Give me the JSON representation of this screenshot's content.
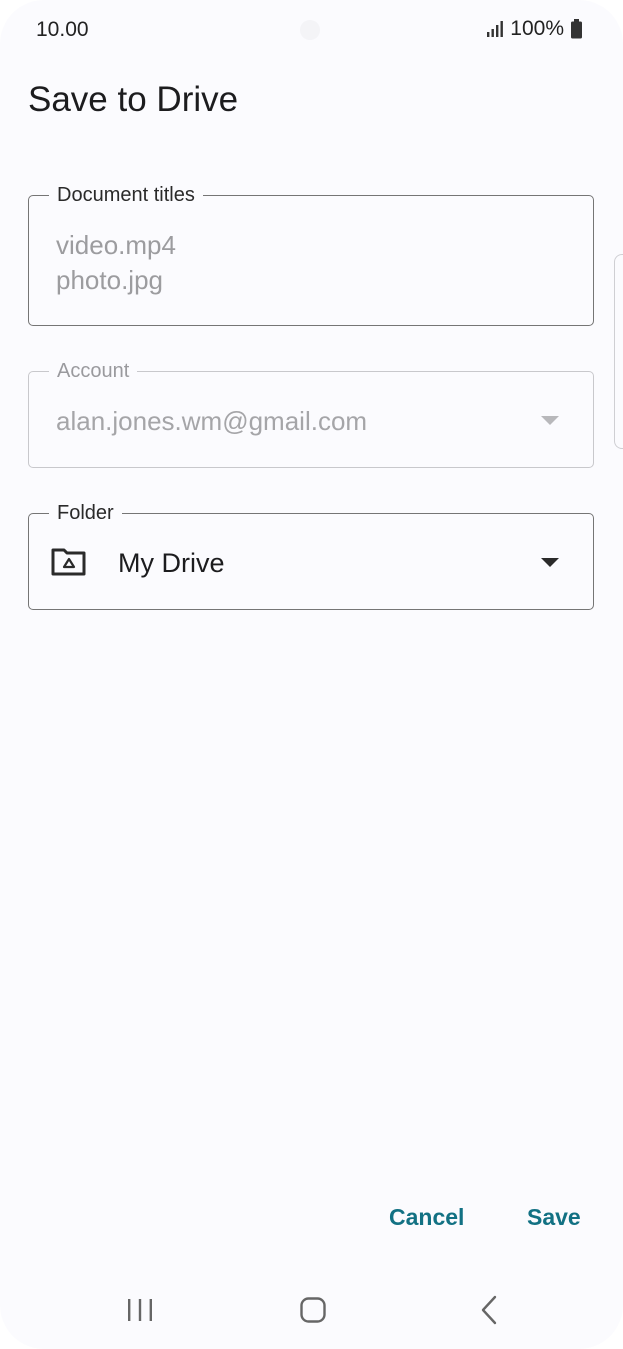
{
  "status_bar": {
    "time": "10.00",
    "battery_percent": "100%",
    "icons": [
      "signal-icon",
      "battery-icon"
    ]
  },
  "dialog": {
    "title": "Save to Drive",
    "document_titles": {
      "label": "Document titles",
      "values": [
        "video.mp4",
        "photo.jpg"
      ]
    },
    "account": {
      "label": "Account",
      "value": "alan.jones.wm@gmail.com",
      "enabled": false
    },
    "folder": {
      "label": "Folder",
      "value": "My Drive",
      "icon": "drive-folder-icon"
    },
    "cancel_label": "Cancel",
    "save_label": "Save"
  },
  "colors": {
    "accent": "#127183",
    "background": "#fbfbfe",
    "outline": "#757575",
    "disabled_text": "#a5a5a8"
  },
  "nav_bar": {
    "icons": [
      "recents-icon",
      "home-icon",
      "back-icon"
    ]
  }
}
